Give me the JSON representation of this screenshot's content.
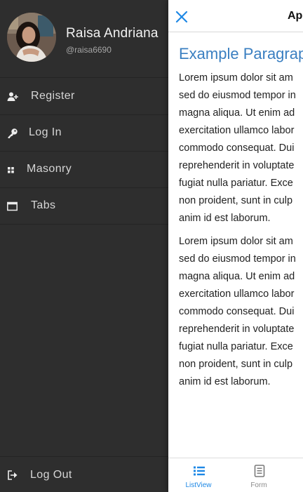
{
  "drawer": {
    "user": {
      "name": "Raisa Andriana",
      "handle": "@raisa6690"
    },
    "items": [
      {
        "label": "Register",
        "icon": "add-user-icon"
      },
      {
        "label": "Log In",
        "icon": "key-icon"
      },
      {
        "label": "Masonry",
        "icon": "grid-icon"
      },
      {
        "label": "Tabs",
        "icon": "window-icon"
      }
    ],
    "logout": {
      "label": "Log Out",
      "icon": "sign-out-icon"
    }
  },
  "main": {
    "title": "Ap",
    "heading": "Example Paragrap",
    "paragraphs": [
      "Lorem ipsum dolor sit am\nsed do eiusmod tempor in\nmagna aliqua. Ut enim ad\nexercitation ullamco labor\ncommodo consequat. Dui\nreprehenderit in voluptate\nfugiat nulla pariatur. Exce\nnon proident, sunt in culp\nanim id est laborum.",
      "Lorem ipsum dolor sit am\nsed do eiusmod tempor in\nmagna aliqua. Ut enim ad\nexercitation ullamco labor\ncommodo consequat. Dui\nreprehenderit in voluptate\nfugiat nulla pariatur. Exce\nnon proident, sunt in culp\nanim id est laborum."
    ],
    "tabs": [
      {
        "label": "ListView",
        "icon": "list-icon",
        "active": true
      },
      {
        "label": "Form",
        "icon": "document-icon",
        "active": false
      }
    ]
  },
  "colors": {
    "drawer_bg": "#2e2e2e",
    "accent": "#1e88e5",
    "heading": "#3a7fc1",
    "inactive_tab": "#8a8a8a"
  }
}
